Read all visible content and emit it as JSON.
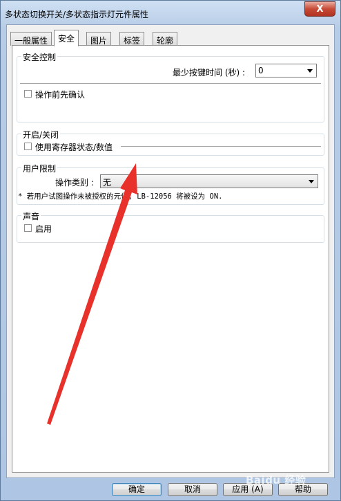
{
  "window": {
    "title": "多状态切换开关/多状态指示灯元件属性",
    "close_symbol": "X"
  },
  "tabs": [
    {
      "label": "一般属性",
      "active": false
    },
    {
      "label": "安全",
      "active": true
    },
    {
      "label": "图片",
      "active": false
    },
    {
      "label": "标签",
      "active": false
    },
    {
      "label": "轮廓",
      "active": false
    }
  ],
  "security_control": {
    "title": "安全控制",
    "min_press_time_label": "最少按键时间 (秒) :",
    "min_press_time_value": "0",
    "confirm_before_operation": {
      "label": "操作前先确认",
      "checked": false
    }
  },
  "on_off": {
    "title": "开启/关闭",
    "use_register_state": {
      "label": "使用寄存器状态/数值",
      "checked": false
    }
  },
  "user_restriction": {
    "title": "用户限制",
    "operation_type_label": "操作类别 :",
    "operation_type_value": "无",
    "note": "* 若用户试图操作未被授权的元件, LB-12056 将被设为 ON."
  },
  "sound": {
    "title": "声音",
    "enable": {
      "label": "启用",
      "checked": false
    }
  },
  "buttons": {
    "ok": "确定",
    "cancel": "取消",
    "apply": "应用 (A)",
    "help": "帮助"
  },
  "annotation": {
    "arrow_color": "#e8312a"
  },
  "watermark": "Baidu 经验"
}
